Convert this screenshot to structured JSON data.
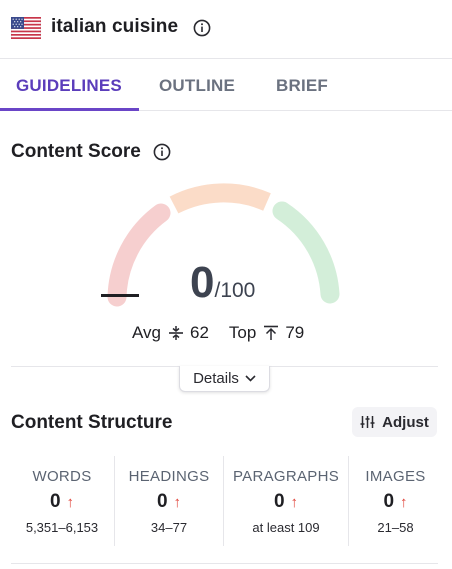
{
  "header": {
    "keyword": "italian cuisine",
    "flag_icon": "us-flag-icon",
    "info_icon": "info-icon"
  },
  "tabs": [
    {
      "label": "GUIDELINES",
      "active": true
    },
    {
      "label": "OUTLINE",
      "active": false
    },
    {
      "label": "BRIEF",
      "active": false
    }
  ],
  "content_score": {
    "title": "Content Score",
    "score": "0",
    "max": "/100",
    "avg_label": "Avg",
    "avg_value": "62",
    "top_label": "Top",
    "top_value": "79",
    "details_label": "Details",
    "colors": {
      "low": "#f6cfcf",
      "mid": "#fbdcc8",
      "high": "#d3eed9"
    }
  },
  "content_structure": {
    "title": "Content Structure",
    "adjust_label": "Adjust",
    "stats": [
      {
        "label": "WORDS",
        "value": "0",
        "range": "5,351–6,153"
      },
      {
        "label": "HEADINGS",
        "value": "0",
        "range": "34–77"
      },
      {
        "label": "PARAGRAPHS",
        "value": "0",
        "range": "at least 109"
      },
      {
        "label": "IMAGES",
        "value": "0",
        "range": "21–58"
      }
    ],
    "arrow": "↑"
  }
}
